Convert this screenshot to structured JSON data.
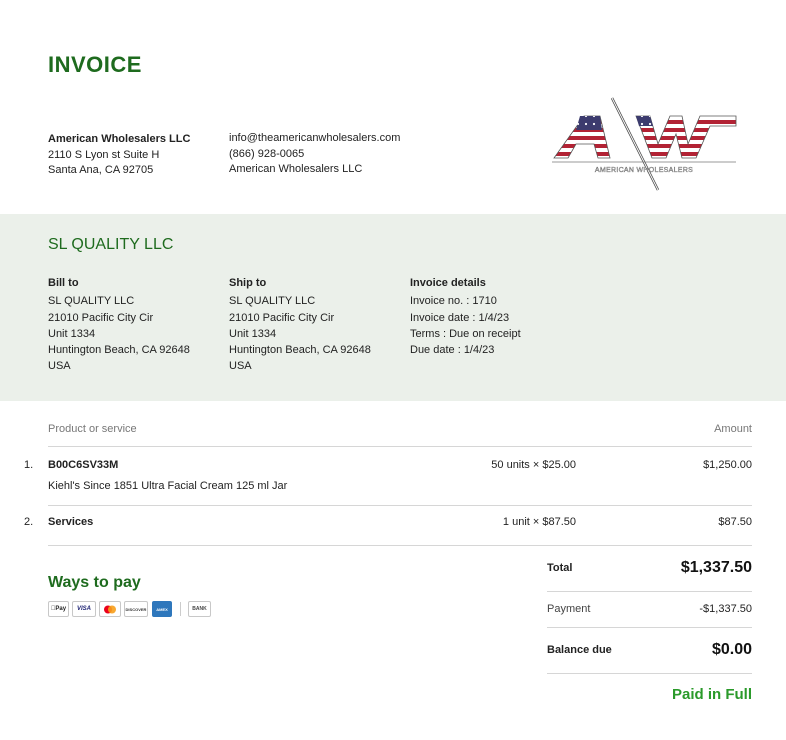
{
  "invoice": {
    "title": "INVOICE",
    "seller": {
      "name": "American Wholesalers LLC",
      "address1": "2110 S Lyon st Suite H",
      "address2": "Santa Ana, CA 92705",
      "email": "info@theamericanwholesalers.com",
      "phone": "(866) 928-0065",
      "company": "American Wholesalers LLC"
    },
    "logo": {
      "letters": "AW",
      "text": "AMERICAN WHOLESALERS",
      "colors": [
        "#b22234",
        "#3c3b6e",
        "#ffffff"
      ]
    },
    "client": "SL QUALITY LLC",
    "bill_to": {
      "heading": "Bill to",
      "lines": [
        "SL QUALITY LLC",
        "21010 Pacific City Cir",
        "Unit 1334",
        "Huntington Beach, CA 92648",
        "USA"
      ]
    },
    "ship_to": {
      "heading": "Ship to",
      "lines": [
        "SL QUALITY LLC",
        "21010 Pacific City Cir",
        "Unit 1334",
        "Huntington Beach, CA 92648",
        "USA"
      ]
    },
    "details": {
      "heading": "Invoice details",
      "lines": [
        "Invoice no. : 1710",
        "Invoice date : 1/4/23",
        "Terms : Due on receipt",
        "Due date : 1/4/23"
      ]
    },
    "table": {
      "col_product": "Product or service",
      "col_amount": "Amount",
      "items": [
        {
          "num": "1.",
          "name": "B00C6SV33M",
          "desc": "Kiehl's Since 1851 Ultra Facial Cream 125 ml Jar",
          "qty": "50 units × $25.00",
          "amount": "$1,250.00"
        },
        {
          "num": "2.",
          "name": "Services",
          "desc": "",
          "qty": "1 unit × $87.50",
          "amount": "$87.50"
        }
      ]
    },
    "ways_to_pay": {
      "heading": "Ways to pay",
      "methods": [
        "Pay",
        "VISA",
        "mastercard",
        "DISCOVER",
        "AMEX",
        "BANK"
      ]
    },
    "totals": {
      "total_label": "Total",
      "total_value": "$1,337.50",
      "payment_label": "Payment",
      "payment_value": "-$1,337.50",
      "balance_label": "Balance due",
      "balance_value": "$0.00",
      "status": "Paid in Full"
    },
    "colors": {
      "accent": "#1e6b1e",
      "band": "#ebf0ea",
      "paid": "#2a9a2a"
    }
  }
}
